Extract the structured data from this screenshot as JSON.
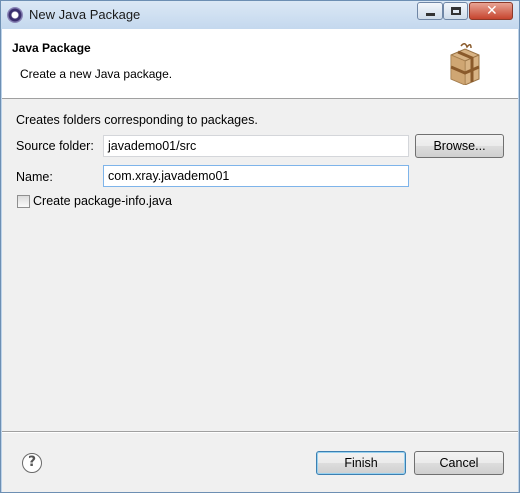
{
  "window": {
    "title": "New Java Package",
    "icons": {
      "app": "eclipse-icon",
      "minimize": "minimize-icon",
      "maximize": "maximize-icon",
      "close": "close-icon"
    }
  },
  "header": {
    "title": "Java Package",
    "description": "Create a new Java package.",
    "icon": "package-icon"
  },
  "form": {
    "intro": "Creates folders corresponding to packages.",
    "source_folder": {
      "label": "Source folder:",
      "value": "javademo01/src"
    },
    "browse_label": "Browse...",
    "name": {
      "label": "Name:",
      "value": "com.xray.javademo01"
    },
    "package_info_checkbox": {
      "label": "Create package-info.java",
      "checked": false
    }
  },
  "footer": {
    "help_icon": "help-icon",
    "finish_label": "Finish",
    "cancel_label": "Cancel"
  },
  "colors": {
    "title_bar": "#c4d8ee",
    "dialog_bg": "#f0f0f0",
    "header_bg": "#ffffff",
    "focus_border": "#7eb4ea",
    "close_button": "#c6442e"
  }
}
